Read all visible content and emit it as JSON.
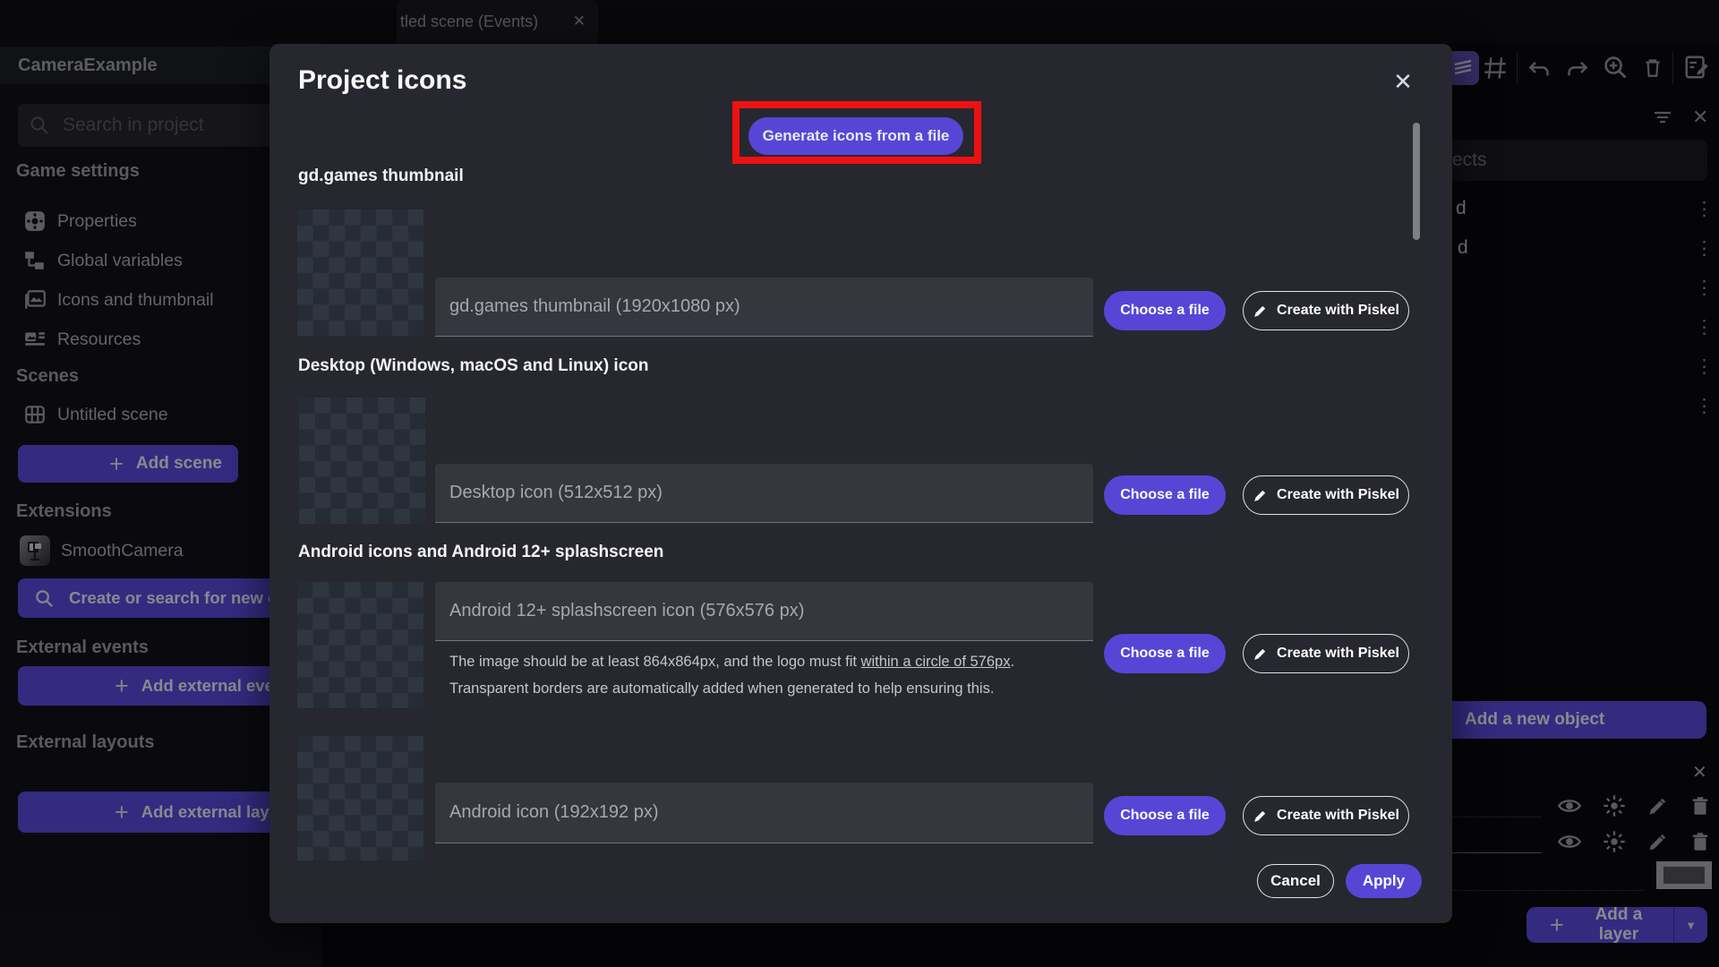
{
  "colors": {
    "primary": "#5746d6",
    "highlight_red": "#ee1111"
  },
  "icons": {
    "close": "✕",
    "kebab": "⋮",
    "caret_down": "▼",
    "plus": "+"
  },
  "tab_bar": {
    "tab_label": "tled scene (Events)"
  },
  "sidebar": {
    "project_name": "CameraExample",
    "search_placeholder": "Search in project",
    "game_settings_heading": "Game settings",
    "item_properties": "Properties",
    "item_global_variables": "Global variables",
    "item_icons_thumbnail": "Icons and thumbnail",
    "item_resources": "Resources",
    "scenes_heading": "Scenes",
    "item_untitled_scene": "Untitled scene",
    "add_scene_label": "Add scene",
    "extensions_heading": "Extensions",
    "item_smooth_camera": "SmoothCamera",
    "create_search_extension_label": "Create or search for new e",
    "external_events_heading": "External events",
    "add_external_events_label": "Add external even",
    "external_layouts_heading": "External layouts",
    "add_external_layouts_label": "Add external layou"
  },
  "objects_panel": {
    "search_fragment": "ects",
    "row_fragment_1": "d",
    "row_fragment_2": "d",
    "add_object_label": "Add a new object"
  },
  "layers_panel": {
    "add_layer_label": "Add a layer"
  },
  "modal": {
    "title": "Project icons",
    "generate_button": "Generate icons from a file",
    "choose_file_label": "Choose a file",
    "piskel_label": "Create with Piskel",
    "cancel_label": "Cancel",
    "apply_label": "Apply",
    "rows": [
      {
        "heading": "gd.games thumbnail",
        "hint": "gd.games thumbnail (1920x1080 px)"
      },
      {
        "heading": "Desktop (Windows, macOS and Linux) icon",
        "hint": "Desktop icon (512x512 px)"
      },
      {
        "heading": "Android icons and Android 12+ splashscreen",
        "hint": "Android 12+ splashscreen icon (576x576 px)",
        "helper_1a": "The image should be at least 864x864px, and the logo must fit ",
        "helper_link": "within a circle of 576px",
        "helper_1b": ".",
        "helper_2": "Transparent borders are automatically added when generated to help ensuring this."
      },
      {
        "hint": "Android icon (192x192 px)"
      }
    ]
  }
}
